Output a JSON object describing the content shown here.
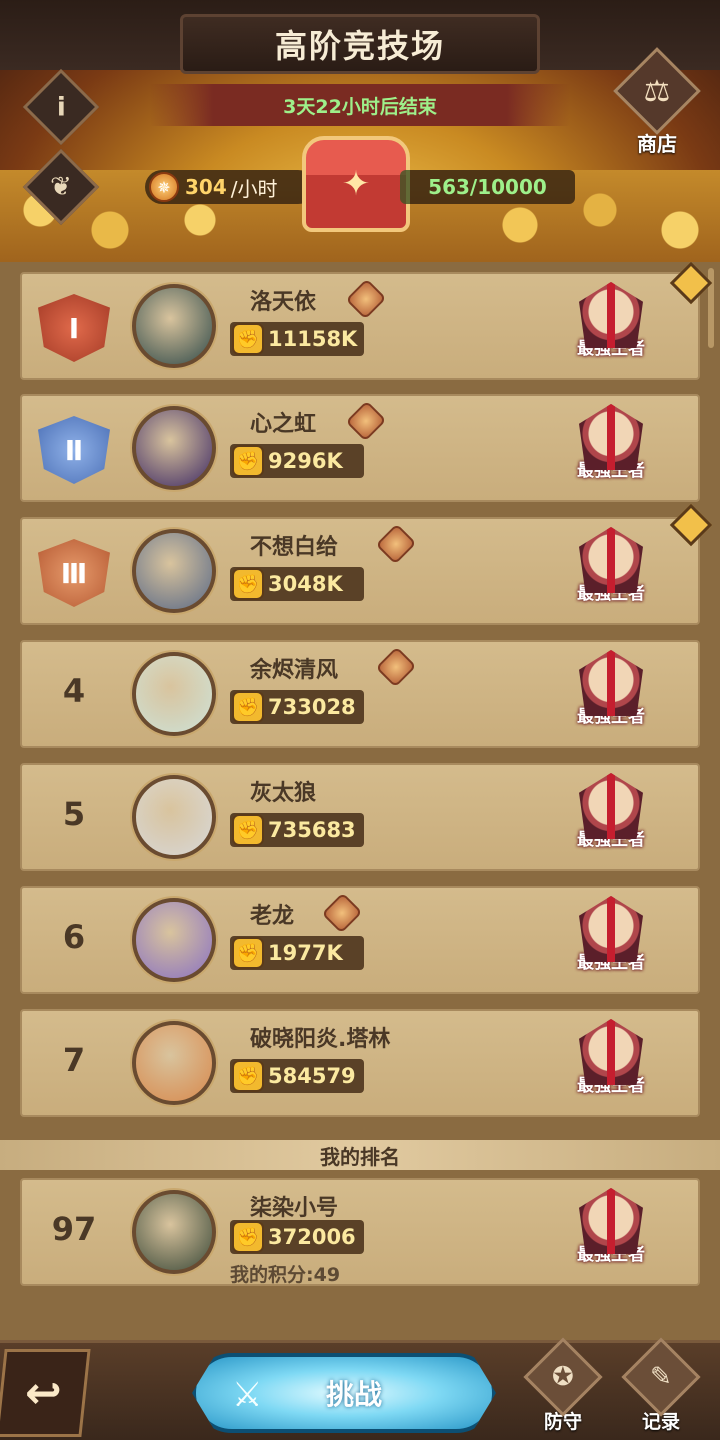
{
  "header": {
    "title": "高阶竞技场",
    "timer": "3天22小时后结束",
    "shop_label": "商店",
    "rate_value": "304",
    "rate_unit": "/小时",
    "progress_text": "563/10000",
    "progress_fraction": 0.0563
  },
  "rows": [
    {
      "rank": "1",
      "name": "洛天依",
      "power": "11158K",
      "title": "最强王者",
      "has_tier_icon": true,
      "avatar_color": "#2f4a4a"
    },
    {
      "rank": "2",
      "name": "心之虹",
      "power": "9296K",
      "title": "最强王者",
      "has_tier_icon": true,
      "avatar_color": "#3e2a66"
    },
    {
      "rank": "3",
      "name": "不想白给",
      "power": "3048K",
      "title": "最强王者",
      "has_tier_icon": true,
      "avatar_color": "#5a6a88"
    },
    {
      "rank": "4",
      "name": "余烬清风",
      "power": "733028",
      "title": "最强王者",
      "has_tier_icon": true,
      "avatar_color": "#cfe3d8"
    },
    {
      "rank": "5",
      "name": "灰太狼",
      "power": "735683",
      "title": "最强王者",
      "has_tier_icon": false,
      "avatar_color": "#d9d9d9"
    },
    {
      "rank": "6",
      "name": "老龙",
      "power": "1977K",
      "title": "最强王者",
      "has_tier_icon": true,
      "avatar_color": "#8a72c4"
    },
    {
      "rank": "7",
      "name": "破晓阳炎.塔林",
      "power": "584579",
      "title": "最强王者",
      "has_tier_icon": false,
      "avatar_color": "#d98a4e"
    }
  ],
  "my_rank": {
    "section_label": "我的排名",
    "rank": "97",
    "name": "柒染小号",
    "power": "372006",
    "score_line": "我的积分:49",
    "title": "最强王者",
    "avatar_color": "#3b4a3a"
  },
  "bottom": {
    "challenge_label": "挑战",
    "defense_label": "防守",
    "record_label": "记录"
  },
  "icons": {
    "info": "i",
    "sprout": "❦",
    "shop": "⚖",
    "coin": "✵",
    "fist": "✊",
    "back": "↩",
    "sword": "⚔",
    "shield": "✪",
    "scroll": "✎"
  }
}
